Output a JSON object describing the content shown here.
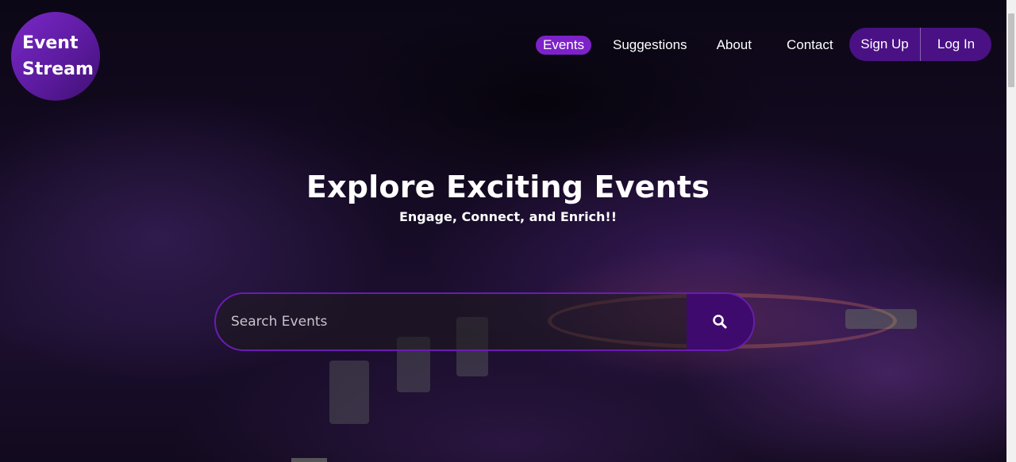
{
  "logo": {
    "line1": "Event",
    "line2": "Stream"
  },
  "nav": {
    "items": [
      {
        "label": "Events",
        "active": true
      },
      {
        "label": "Suggestions",
        "active": false
      },
      {
        "label": "About",
        "active": false
      },
      {
        "label": "Contact",
        "active": false
      }
    ]
  },
  "auth": {
    "signup_label": "Sign Up",
    "login_label": "Log In"
  },
  "hero": {
    "title": "Explore Exciting Events",
    "subtitle": "Engage, Connect, and Enrich!!"
  },
  "search": {
    "placeholder": "Search Events",
    "value": ""
  },
  "colors": {
    "accent": "#7d22c9",
    "button_bg": "#4a1184",
    "search_button_bg": "#3e0a6e"
  },
  "icons": {
    "search": "search-icon"
  }
}
